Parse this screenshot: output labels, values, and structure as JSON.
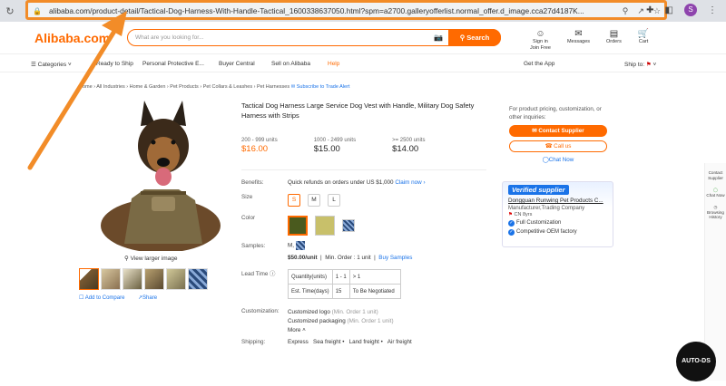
{
  "browser": {
    "url": "alibaba.com/product-detail/Tactical-Dog-Harness-With-Handle-Tactical_1600338637050.html?spm=a2700.galleryofferlist.normal_offer.d_image.cca27d4187K...",
    "profile_initial": "S"
  },
  "header": {
    "logo": "Alibaba.com",
    "search_placeholder": "What are you looking for...",
    "search_button": "Search",
    "icons": [
      {
        "label": "Sign in\nJoin Free",
        "icon": "user-icon"
      },
      {
        "label": "Messages",
        "icon": "message-icon"
      },
      {
        "label": "Orders",
        "icon": "orders-icon"
      },
      {
        "label": "Cart",
        "icon": "cart-icon"
      }
    ]
  },
  "nav": {
    "categories": "Categories",
    "items": [
      "Ready to Ship",
      "Personal Protective E...",
      "Buyer Central",
      "Sell on Alibaba",
      "Help"
    ],
    "get_app": "Get the App",
    "ship_to": "Ship to:"
  },
  "breadcrumb": {
    "items": [
      "Home",
      "All Industries",
      "Home & Garden",
      "Pet Products",
      "Pet Collars & Leashes",
      "Pet Harnesses"
    ],
    "subscribe": "Subscribe to Trade Alert"
  },
  "product": {
    "title": "Tactical Dog Harness Large Service Dog Vest with Handle, Military Dog Safety Harness with Strips",
    "view_larger": "View larger image",
    "add_compare": "Add to Compare",
    "share": "Share",
    "tiers": [
      {
        "qty": "200 - 999 units",
        "price": "$16.00"
      },
      {
        "qty": "1000 - 2499 units",
        "price": "$15.00"
      },
      {
        "qty": ">= 2500 units",
        "price": "$14.00"
      }
    ],
    "benefits_label": "Benefits:",
    "benefits_text": "Quick refunds on orders under US $1,000",
    "claim_now": "Claim now",
    "size_label": "Size",
    "sizes": [
      "S",
      "M",
      "L"
    ],
    "color_label": "Color",
    "colors": [
      "#4a5a1e",
      "#c8c06a",
      "#3a5a8a"
    ],
    "samples_label": "Samples:",
    "samples_value": "M,",
    "sample_price": "$50.00/unit",
    "sample_min": "Min. Order : 1 unit",
    "buy_samples": "Buy Samples",
    "lead_time_label": "Lead Time",
    "lead_table": {
      "row1": [
        "Quantity(units)",
        "1 - 1",
        "> 1"
      ],
      "row2": [
        "Est. Time(days)",
        "15",
        "To Be Negotiated"
      ]
    },
    "customization_label": "Customization:",
    "custom1": "Customized logo",
    "custom1_min": "(Min. Order 1 unit)",
    "custom2": "Customized packaging",
    "custom2_min": "(Min. Order 1 unit)",
    "more": "More",
    "shipping_label": "Shipping:",
    "shipping_items": "Express   Sea freight •   Land freight •   Air freight"
  },
  "sidebar": {
    "info": "For product pricing, customization, or other inquiries:",
    "contact": "Contact Supplier",
    "call": "Call us",
    "chat": "Chat Now",
    "verified": "Verified supplier",
    "company": "Dongguan Runwing Pet Products C...",
    "company_type": "Manufacturer,Trading Company",
    "country": "CN",
    "years": "8yrs",
    "feature1": "Full Customization",
    "feature2": "Competitive OEM factory"
  },
  "right_panel": {
    "contact": "Contact Supplier",
    "chat": "Chat Now",
    "history": "Browsing History"
  },
  "badge": "AUTO-DS"
}
